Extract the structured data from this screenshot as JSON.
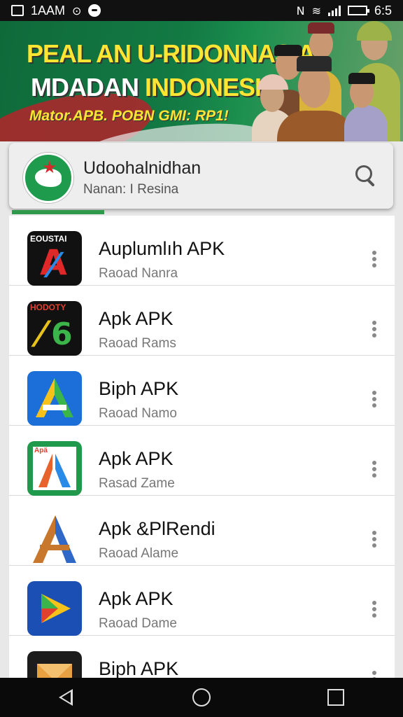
{
  "status_bar": {
    "carrier": "1AAM",
    "time": "6:5",
    "icons": [
      "screenshot-icon",
      "sync-icon",
      "chat-icon",
      "nfc-icon",
      "wifi-icon",
      "signal-icon",
      "battery-icon"
    ]
  },
  "banner": {
    "title_line1": "PEAL AN U-RIDONNASIA",
    "title_line2_white": "MDADAN",
    "title_line2_yellow": "INDONESIA",
    "caption": "Mator.APB. POBN GMI: RP1!"
  },
  "search": {
    "title": "Udoohalnidhan",
    "subtitle": "Nanan: I Resina"
  },
  "apps": [
    {
      "title": "Auplumlıh APK",
      "subtitle": "Raoad Nanra",
      "icon_text": "EOUSTAI",
      "icon": "a-letter-icon"
    },
    {
      "title": "Apk APK",
      "subtitle": "Raoad Rams",
      "icon_text": "HODOTY",
      "icon": "a6-letter-icon"
    },
    {
      "title": "Biph APK",
      "subtitle": "Raoad Namo",
      "icon_text": "",
      "icon": "a-triangle-icon"
    },
    {
      "title": "Apk APK",
      "subtitle": "Rasad Zame",
      "icon_text": "Apä",
      "icon": "a-map-icon"
    },
    {
      "title": "Apk &PlRendi",
      "subtitle": "Raoad Alame",
      "icon_text": "",
      "icon": "a-orange-icon"
    },
    {
      "title": "Apk APK",
      "subtitle": "Raoad Dame",
      "icon_text": "",
      "icon": "play-triangle-icon"
    },
    {
      "title": "Biph APK",
      "subtitle": "",
      "icon_text": "",
      "icon": "envelope-icon"
    }
  ],
  "colors": {
    "banner_green": "#137a44",
    "banner_yellow": "#ffe533",
    "accent_green": "#2f9a4c"
  }
}
